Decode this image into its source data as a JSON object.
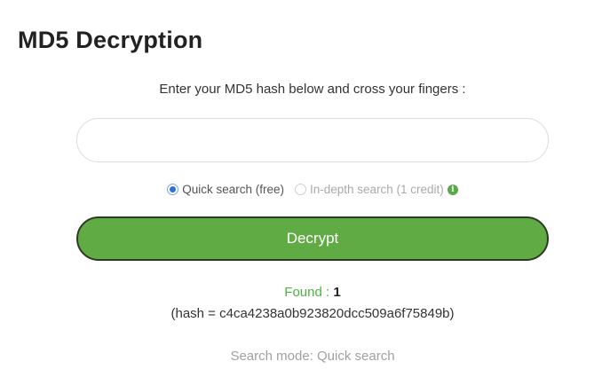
{
  "page": {
    "title": "MD5 Decryption",
    "instruction": "Enter your MD5 hash below and cross your fingers :"
  },
  "form": {
    "hash_input_value": "",
    "hash_input_placeholder": "",
    "options": {
      "quick": {
        "label": "Quick search (free)",
        "checked": true
      },
      "indepth": {
        "label": "In-depth search (1 credit)",
        "disabled": true
      }
    },
    "info_icon": "info-icon",
    "submit_label": "Decrypt"
  },
  "result": {
    "found_label": "Found :",
    "found_value": "1",
    "hash_text": "(hash = c4ca4238a0b923820dcc509a6f75849b)",
    "search_mode": "Search mode: Quick search"
  },
  "colors": {
    "accent_green": "#61ab45",
    "found_green": "#4db043",
    "radio_blue": "#2f6fdb"
  }
}
